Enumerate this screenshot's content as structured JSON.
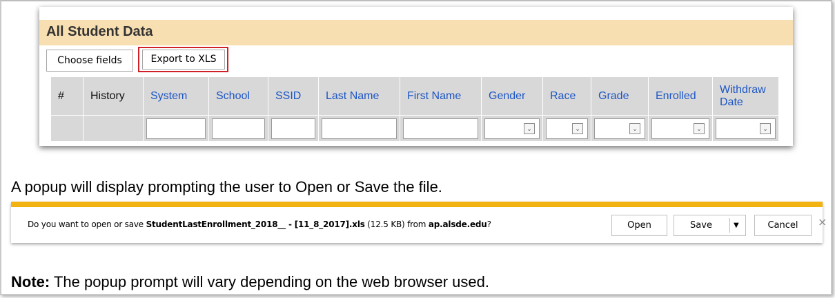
{
  "panel": {
    "title": "All Student Data",
    "choose_fields": "Choose fields",
    "export_xls": "Export to XLS",
    "columns": [
      "#",
      "History",
      "System",
      "School",
      "SSID",
      "Last Name",
      "First Name",
      "Gender",
      "Race",
      "Grade",
      "Enrolled",
      "Withdraw Date"
    ],
    "dropdown_glyph": "chevron-down-icon"
  },
  "instruction": "A popup will display prompting the user to Open or Save the file.",
  "download_bar": {
    "prompt_prefix": "Do you want to open or save ",
    "file_name": "StudentLastEnrollment_2018__ - [11_8_2017].xls",
    "size": " (12.5 KB) from ",
    "host": "ap.alsde.edu",
    "suffix": "?",
    "open": "Open",
    "save": "Save",
    "cancel": "Cancel",
    "close": "×",
    "accent_color": "#f2b211"
  },
  "note": {
    "label": "Note:",
    "text": " The popup prompt will vary depending on the web browser used."
  }
}
